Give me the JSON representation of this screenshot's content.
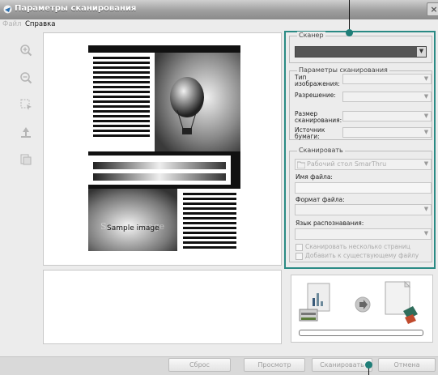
{
  "window": {
    "title": "Параметры сканирования",
    "close_glyph": "×"
  },
  "menu": [
    {
      "label": "Файл"
    },
    {
      "label": "Справка"
    }
  ],
  "toolbar": [
    {
      "icon": "zoom-in-icon"
    },
    {
      "icon": "zoom-out-icon"
    },
    {
      "icon": "select-area-icon"
    },
    {
      "icon": "rotate-icon"
    },
    {
      "icon": "fit-page-icon"
    }
  ],
  "preview": {
    "sample_text_1": "Sample image",
    "sample_text_2": "Sample image"
  },
  "settings": {
    "scanner_legend": "Сканер",
    "params_legend": "Параметры сканирования",
    "image_type_label": "Тип изображения:",
    "resolution_label": "Разрешение:",
    "scan_size_label": "Размер сканирования:",
    "paper_source_label": "Источник бумаги:",
    "scan_to_legend": "Сканировать",
    "scan_to_value": "Рабочий стол SmarThru",
    "file_name_label": "Имя файла:",
    "file_format_label": "Формат файла:",
    "ocr_lang_label": "Язык распознавания:",
    "multi_page_label": "Сканировать несколько страниц",
    "append_label": "Добавить к существующему файлу"
  },
  "buttons": {
    "reset": "Сброс",
    "preview": "Просмотр",
    "scan": "Сканировать",
    "cancel": "Отмена"
  },
  "colors": {
    "accent": "#2a8a84",
    "titlebar": "#9f9f9f",
    "callout_dot": "#1f7e78"
  }
}
